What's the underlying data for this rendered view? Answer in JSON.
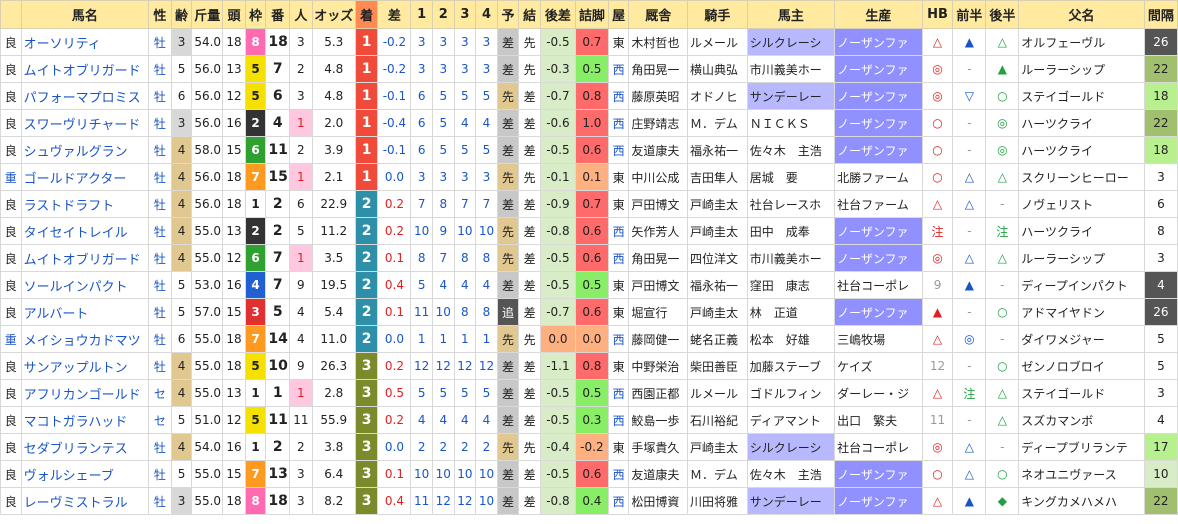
{
  "headers": [
    "",
    "馬名",
    "性",
    "齢",
    "斤量",
    "頭",
    "枠",
    "番",
    "人",
    "オッズ",
    "着",
    "差",
    "1",
    "2",
    "3",
    "4",
    "予",
    "結",
    "後差",
    "詰脚",
    "屋",
    "厩舎",
    "騎手",
    "馬主",
    "生産",
    "HB",
    "前半",
    "後半",
    "父名",
    "間隔"
  ],
  "rows": [
    {
      "baba": "良",
      "name": "オーソリティ",
      "sex": "牡",
      "age": "3",
      "kin": "54.0",
      "tou": "18",
      "waku": "8",
      "ban": "18",
      "nin": "3",
      "odds": "5.3",
      "chaku": "1",
      "sa": "-0.2",
      "c1": "3",
      "c2": "3",
      "c3": "3",
      "c4": "3",
      "yo": "差",
      "ketsu": "先",
      "ato": "-0.5",
      "tsume": "0.7",
      "ya": "東",
      "stable": "木村哲也",
      "jockey": "ルメール",
      "owner": "シルクレーシ",
      "breeder": "ノーザンファ",
      "hb": "△",
      "zen": "▲",
      "kou": "△",
      "sire": "オルフェーヴル",
      "kan": "26"
    },
    {
      "baba": "良",
      "name": "ムイトオブリガード",
      "sex": "牡",
      "age": "5",
      "kin": "56.0",
      "tou": "13",
      "waku": "5",
      "ban": "7",
      "nin": "2",
      "odds": "4.8",
      "chaku": "1",
      "sa": "-0.2",
      "c1": "3",
      "c2": "3",
      "c3": "3",
      "c4": "3",
      "yo": "差",
      "ketsu": "先",
      "ato": "-0.3",
      "tsume": "0.5",
      "ya": "西",
      "stable": "角田晃一",
      "jockey": "横山典弘",
      "owner": "市川義美ホー",
      "breeder": "ノーザンファ",
      "hb": "◎",
      "zen": "-",
      "kou": "▲",
      "sire": "ルーラーシップ",
      "kan": "22"
    },
    {
      "baba": "良",
      "name": "パフォーマプロミス",
      "sex": "牡",
      "age": "6",
      "kin": "56.0",
      "tou": "12",
      "waku": "5",
      "ban": "6",
      "nin": "3",
      "odds": "4.8",
      "chaku": "1",
      "sa": "-0.1",
      "c1": "6",
      "c2": "5",
      "c3": "5",
      "c4": "5",
      "yo": "先",
      "ketsu": "差",
      "ato": "-0.7",
      "tsume": "0.8",
      "ya": "西",
      "stable": "藤原英昭",
      "jockey": "オドノヒ",
      "owner": "サンデーレー",
      "breeder": "ノーザンファ",
      "hb": "◎",
      "zen": "▽",
      "kou": "○",
      "sire": "ステイゴールド",
      "kan": "18"
    },
    {
      "baba": "良",
      "name": "スワーヴリチャード",
      "sex": "牡",
      "age": "3",
      "kin": "56.0",
      "tou": "16",
      "waku": "2",
      "ban": "4",
      "nin": "1",
      "odds": "2.0",
      "chaku": "1",
      "sa": "-0.4",
      "c1": "6",
      "c2": "5",
      "c3": "4",
      "c4": "4",
      "yo": "差",
      "ketsu": "差",
      "ato": "-0.6",
      "tsume": "1.0",
      "ya": "西",
      "stable": "庄野靖志",
      "jockey": "Ｍ．デム",
      "owner": "ＮＩＣＫＳ",
      "breeder": "ノーザンファ",
      "hb": "○",
      "zen": "-",
      "kou": "◎",
      "sire": "ハーツクライ",
      "kan": "22"
    },
    {
      "baba": "良",
      "name": "シュヴァルグラン",
      "sex": "牡",
      "age": "4",
      "kin": "58.0",
      "tou": "15",
      "waku": "6",
      "ban": "11",
      "nin": "2",
      "odds": "3.9",
      "chaku": "1",
      "sa": "-0.1",
      "c1": "6",
      "c2": "5",
      "c3": "5",
      "c4": "5",
      "yo": "差",
      "ketsu": "差",
      "ato": "-0.5",
      "tsume": "0.6",
      "ya": "西",
      "stable": "友道康夫",
      "jockey": "福永祐一",
      "owner": "佐々木　主浩",
      "breeder": "ノーザンファ",
      "hb": "○",
      "zen": "-",
      "kou": "◎",
      "sire": "ハーツクライ",
      "kan": "18"
    },
    {
      "baba": "重",
      "name": "ゴールドアクター",
      "sex": "牡",
      "age": "4",
      "kin": "56.0",
      "tou": "18",
      "waku": "7",
      "ban": "15",
      "nin": "1",
      "odds": "2.1",
      "chaku": "1",
      "sa": "0.0",
      "c1": "3",
      "c2": "3",
      "c3": "3",
      "c4": "3",
      "yo": "先",
      "ketsu": "先",
      "ato": "-0.1",
      "tsume": "0.1",
      "ya": "東",
      "stable": "中川公成",
      "jockey": "吉田隼人",
      "owner": "居城　要",
      "breeder": "北勝ファーム",
      "hb": "○",
      "zen": "△",
      "kou": "△",
      "sire": "スクリーンヒーロー",
      "kan": "3"
    },
    {
      "baba": "良",
      "name": "ラストドラフト",
      "sex": "牡",
      "age": "4",
      "kin": "56.0",
      "tou": "18",
      "waku": "1",
      "ban": "2",
      "nin": "6",
      "odds": "22.9",
      "chaku": "2",
      "sa": "0.2",
      "c1": "7",
      "c2": "8",
      "c3": "7",
      "c4": "7",
      "yo": "差",
      "ketsu": "差",
      "ato": "-0.9",
      "tsume": "0.7",
      "ya": "東",
      "stable": "戸田博文",
      "jockey": "戸崎圭太",
      "owner": "社台レースホ",
      "breeder": "社台ファーム",
      "hb": "△",
      "zen": "△",
      "kou": "-",
      "sire": "ノヴェリスト",
      "kan": "6"
    },
    {
      "baba": "良",
      "name": "タイセイトレイル",
      "sex": "牡",
      "age": "4",
      "kin": "55.0",
      "tou": "13",
      "waku": "2",
      "ban": "2",
      "nin": "5",
      "odds": "11.2",
      "chaku": "2",
      "sa": "0.2",
      "c1": "10",
      "c2": "9",
      "c3": "10",
      "c4": "10",
      "yo": "先",
      "ketsu": "差",
      "ato": "-0.8",
      "tsume": "0.6",
      "ya": "西",
      "stable": "矢作芳人",
      "jockey": "戸崎圭太",
      "owner": "田中　成奉",
      "breeder": "ノーザンファ",
      "hb": "注",
      "zen": "-",
      "kou": "注",
      "sire": "ハーツクライ",
      "kan": "8"
    },
    {
      "baba": "良",
      "name": "ムイトオブリガード",
      "sex": "牡",
      "age": "4",
      "kin": "55.0",
      "tou": "12",
      "waku": "6",
      "ban": "7",
      "nin": "1",
      "odds": "3.5",
      "chaku": "2",
      "sa": "0.1",
      "c1": "8",
      "c2": "7",
      "c3": "8",
      "c4": "8",
      "yo": "先",
      "ketsu": "差",
      "ato": "-0.5",
      "tsume": "0.6",
      "ya": "西",
      "stable": "角田晃一",
      "jockey": "四位洋文",
      "owner": "市川義美ホー",
      "breeder": "ノーザンファ",
      "hb": "◎",
      "zen": "△",
      "kou": "△",
      "sire": "ルーラーシップ",
      "kan": "3"
    },
    {
      "baba": "良",
      "name": "ソールインパクト",
      "sex": "牡",
      "age": "5",
      "kin": "53.0",
      "tou": "16",
      "waku": "4",
      "ban": "7",
      "nin": "9",
      "odds": "19.5",
      "chaku": "2",
      "sa": "0.4",
      "c1": "5",
      "c2": "4",
      "c3": "4",
      "c4": "4",
      "yo": "差",
      "ketsu": "差",
      "ato": "-0.5",
      "tsume": "0.5",
      "ya": "東",
      "stable": "戸田博文",
      "jockey": "福永祐一",
      "owner": "窪田　康志",
      "breeder": "社台コーポレ",
      "hb": "9",
      "zen": "▲",
      "kou": "-",
      "sire": "ディープインパクト",
      "kan": "4"
    },
    {
      "baba": "良",
      "name": "アルバート",
      "sex": "牡",
      "age": "5",
      "kin": "57.0",
      "tou": "15",
      "waku": "3",
      "ban": "5",
      "nin": "4",
      "odds": "5.4",
      "chaku": "2",
      "sa": "0.1",
      "c1": "11",
      "c2": "10",
      "c3": "8",
      "c4": "8",
      "yo": "追",
      "ketsu": "差",
      "ato": "-0.7",
      "tsume": "0.6",
      "ya": "東",
      "stable": "堀宣行",
      "jockey": "戸崎圭太",
      "owner": "林　正道",
      "breeder": "ノーザンファ",
      "hb": "▲",
      "zen": "-",
      "kou": "○",
      "sire": "アドマイヤドン",
      "kan": "26"
    },
    {
      "baba": "重",
      "name": "メイショウカドマツ",
      "sex": "牡",
      "age": "6",
      "kin": "55.0",
      "tou": "18",
      "waku": "7",
      "ban": "14",
      "nin": "4",
      "odds": "11.0",
      "chaku": "2",
      "sa": "0.0",
      "c1": "1",
      "c2": "1",
      "c3": "1",
      "c4": "1",
      "yo": "先",
      "ketsu": "先",
      "ato": "0.0",
      "tsume": "0.0",
      "ya": "西",
      "stable": "藤岡健一",
      "jockey": "蛯名正義",
      "owner": "松本　好雄",
      "breeder": "三嶋牧場",
      "hb": "△",
      "zen": "◎",
      "kou": "-",
      "sire": "ダイワメジャー",
      "kan": "5"
    },
    {
      "baba": "良",
      "name": "サンアップルトン",
      "sex": "牡",
      "age": "4",
      "kin": "55.0",
      "tou": "18",
      "waku": "5",
      "ban": "10",
      "nin": "9",
      "odds": "26.3",
      "chaku": "3",
      "sa": "0.2",
      "c1": "12",
      "c2": "12",
      "c3": "12",
      "c4": "12",
      "yo": "差",
      "ketsu": "差",
      "ato": "-1.1",
      "tsume": "0.8",
      "ya": "東",
      "stable": "中野栄治",
      "jockey": "柴田善臣",
      "owner": "加藤ステーブ",
      "breeder": "ケイズ",
      "hb": "12",
      "zen": "-",
      "kou": "○",
      "sire": "ゼンノロブロイ",
      "kan": "5"
    },
    {
      "baba": "良",
      "name": "アフリカンゴールド",
      "sex": "セ",
      "age": "4",
      "kin": "55.0",
      "tou": "13",
      "waku": "1",
      "ban": "1",
      "nin": "1",
      "odds": "2.8",
      "chaku": "3",
      "sa": "0.5",
      "c1": "5",
      "c2": "5",
      "c3": "5",
      "c4": "5",
      "yo": "差",
      "ketsu": "差",
      "ato": "-0.5",
      "tsume": "0.5",
      "ya": "西",
      "stable": "西園正都",
      "jockey": "ルメール",
      "owner": "ゴドルフィン",
      "breeder": "ダーレー・ジ",
      "hb": "△",
      "zen": "注",
      "kou": "△",
      "sire": "ステイゴールド",
      "kan": "3"
    },
    {
      "baba": "良",
      "name": "マコトガラハッド",
      "sex": "セ",
      "age": "5",
      "kin": "51.0",
      "tou": "12",
      "waku": "5",
      "ban": "11",
      "nin": "11",
      "odds": "55.9",
      "chaku": "3",
      "sa": "0.2",
      "c1": "4",
      "c2": "4",
      "c3": "4",
      "c4": "4",
      "yo": "差",
      "ketsu": "差",
      "ato": "-0.5",
      "tsume": "0.3",
      "ya": "西",
      "stable": "鮫島一歩",
      "jockey": "石川裕紀",
      "owner": "ディアマント",
      "breeder": "出口　繁夫",
      "hb": "11",
      "zen": "-",
      "kou": "△",
      "sire": "スズカマンボ",
      "kan": "4"
    },
    {
      "baba": "良",
      "name": "セダブリランテス",
      "sex": "牡",
      "age": "4",
      "kin": "54.0",
      "tou": "16",
      "waku": "1",
      "ban": "2",
      "nin": "2",
      "odds": "3.8",
      "chaku": "3",
      "sa": "0.0",
      "c1": "2",
      "c2": "2",
      "c3": "2",
      "c4": "2",
      "yo": "先",
      "ketsu": "先",
      "ato": "-0.4",
      "tsume": "-0.2",
      "ya": "東",
      "stable": "手塚貴久",
      "jockey": "戸崎圭太",
      "owner": "シルクレーシ",
      "breeder": "社台コーポレ",
      "hb": "◎",
      "zen": "△",
      "kou": "-",
      "sire": "ディープブリランテ",
      "kan": "17"
    },
    {
      "baba": "良",
      "name": "ヴォルシェーブ",
      "sex": "牡",
      "age": "5",
      "kin": "55.0",
      "tou": "15",
      "waku": "7",
      "ban": "13",
      "nin": "3",
      "odds": "6.4",
      "chaku": "3",
      "sa": "0.1",
      "c1": "10",
      "c2": "10",
      "c3": "10",
      "c4": "10",
      "yo": "差",
      "ketsu": "差",
      "ato": "-0.5",
      "tsume": "0.6",
      "ya": "西",
      "stable": "友道康夫",
      "jockey": "Ｍ．デム",
      "owner": "佐々木　主浩",
      "breeder": "ノーザンファ",
      "hb": "○",
      "zen": "△",
      "kou": "○",
      "sire": "ネオユニヴァース",
      "kan": "10"
    },
    {
      "baba": "良",
      "name": "レーヴミストラル",
      "sex": "牡",
      "age": "3",
      "kin": "55.0",
      "tou": "18",
      "waku": "8",
      "ban": "18",
      "nin": "3",
      "odds": "8.2",
      "chaku": "3",
      "sa": "0.4",
      "c1": "11",
      "c2": "12",
      "c3": "12",
      "c4": "10",
      "yo": "差",
      "ketsu": "差",
      "ato": "-0.8",
      "tsume": "0.4",
      "ya": "西",
      "stable": "松田博資",
      "jockey": "川田将雅",
      "owner": "サンデーレー",
      "breeder": "ノーザンファ",
      "hb": "△",
      "zen": "▲",
      "kou": "◆",
      "sire": "キングカメハメハ",
      "kan": "22"
    }
  ]
}
